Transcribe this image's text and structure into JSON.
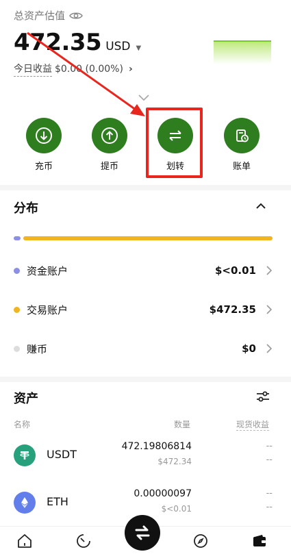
{
  "header": {
    "title": "总资产估值",
    "balance": "472.35",
    "currency": "USD",
    "today_label": "今日收益",
    "today_value": "$0.00 (0.00%)"
  },
  "actions": [
    {
      "label": "充币",
      "icon": "arrow-down-circle-icon"
    },
    {
      "label": "提币",
      "icon": "arrow-up-circle-icon"
    },
    {
      "label": "划转",
      "icon": "transfer-icon"
    },
    {
      "label": "账单",
      "icon": "bill-icon"
    }
  ],
  "distribution": {
    "title": "分布",
    "accounts": [
      {
        "name": "资金账户",
        "amount": "$<0.01",
        "color": "#8b8fe6"
      },
      {
        "name": "交易账户",
        "amount": "$472.35",
        "color": "#f0b521"
      },
      {
        "name": "赚币",
        "amount": "$0",
        "color": "#dcdcdc"
      }
    ]
  },
  "assets": {
    "title": "资产",
    "columns": {
      "name": "名称",
      "qty": "数量",
      "pnl": "现货收益"
    },
    "rows": [
      {
        "symbol": "USDT",
        "qty": "472.19806814",
        "usd": "$472.34",
        "pnl1": "--",
        "pnl2": "--",
        "color": "#26a17b"
      },
      {
        "symbol": "ETH",
        "qty": "0.00000097",
        "usd": "$<0.01",
        "pnl1": "--",
        "pnl2": "--",
        "color": "#627eea"
      }
    ]
  },
  "colors": {
    "accent_green": "#2e7d1f",
    "highlight_red": "#e8261e",
    "bar_yellow": "#f0b521",
    "bar_purple": "#8b8fe6"
  }
}
